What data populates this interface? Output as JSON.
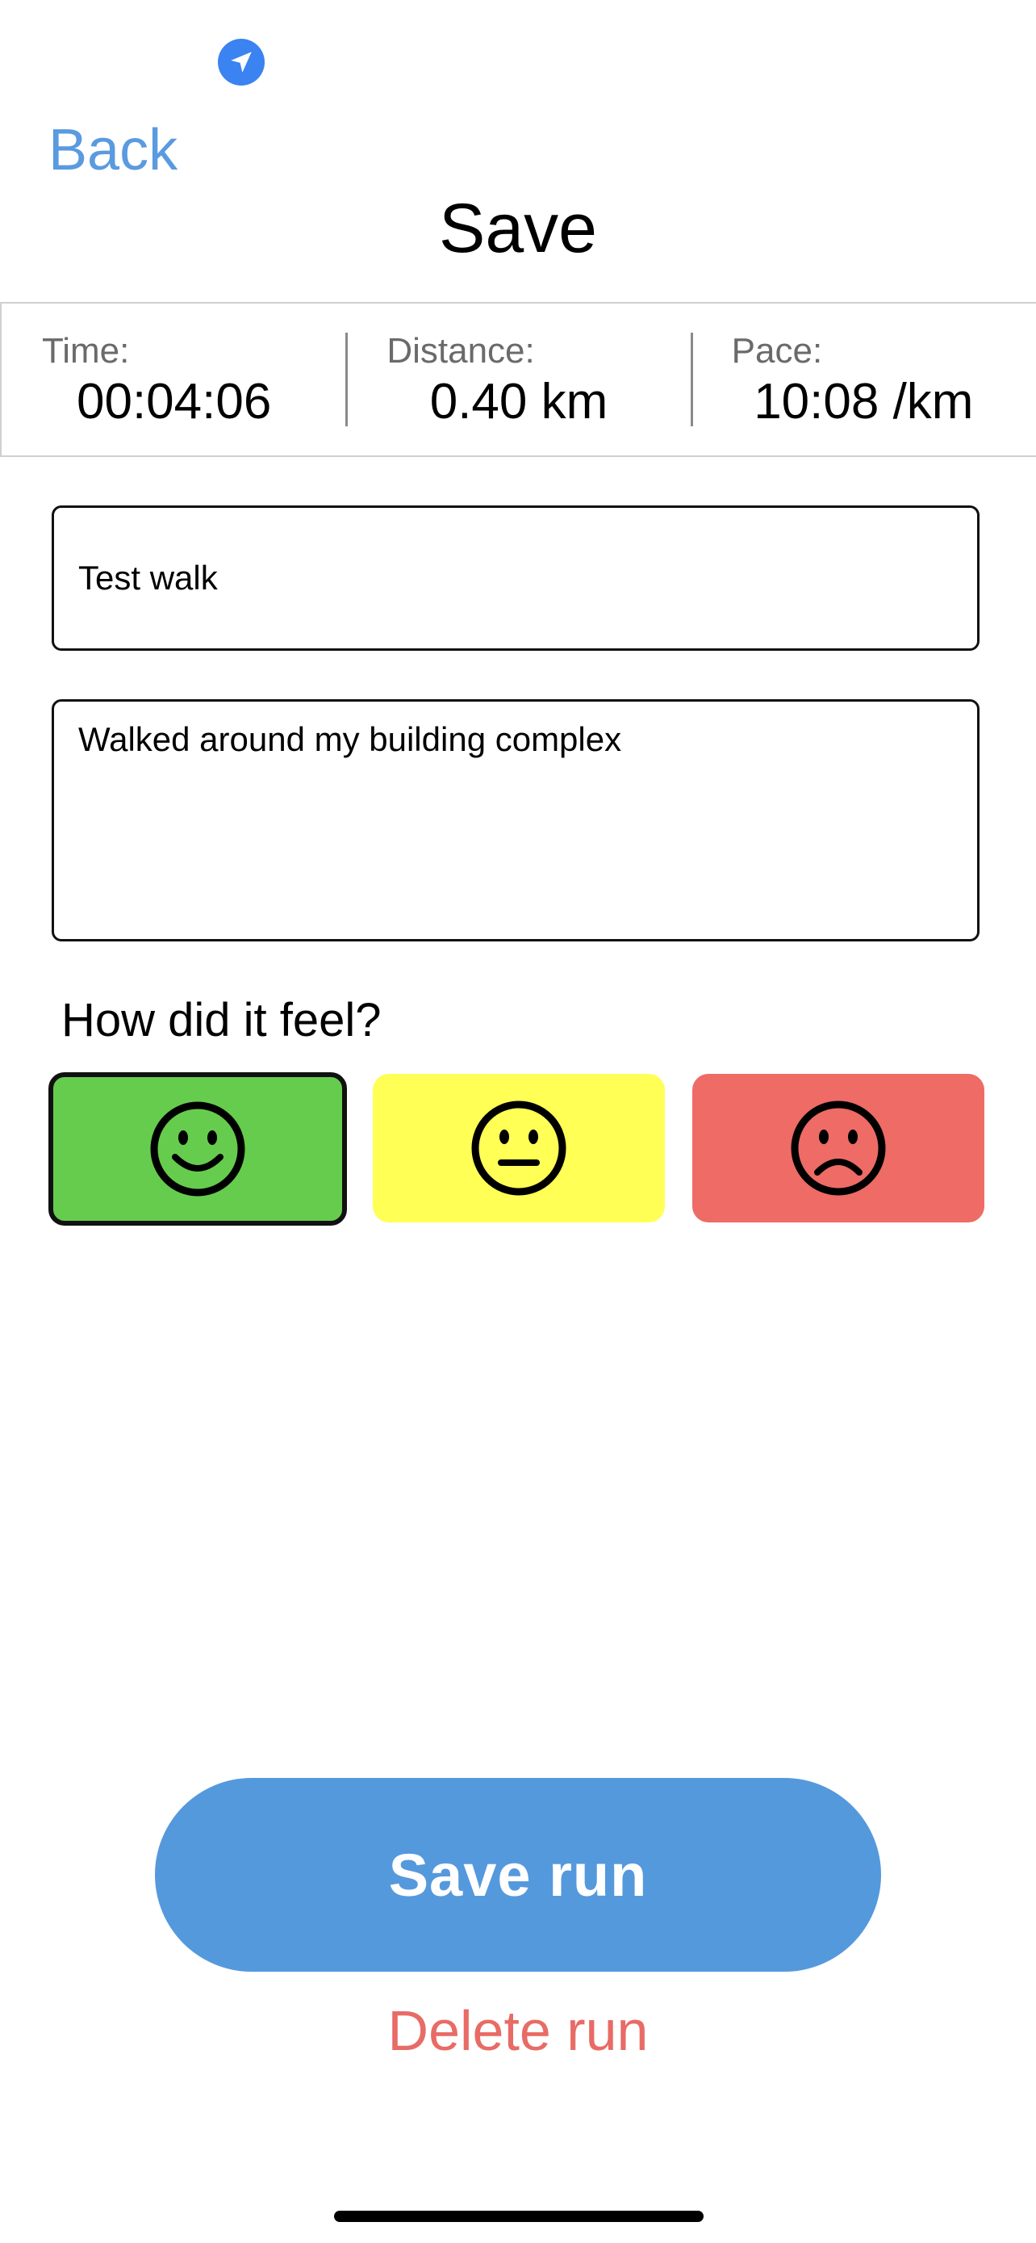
{
  "nav": {
    "back_label": "Back",
    "title": "Save"
  },
  "stats": [
    {
      "label": "Time:",
      "value": "00:04:06"
    },
    {
      "label": "Distance:",
      "value": "0.40 km"
    },
    {
      "label": "Pace:",
      "value": "10:08 /km"
    }
  ],
  "form": {
    "name_value": "Test walk",
    "notes_value": "Walked around my building complex",
    "feel_label": "How did it feel?"
  },
  "moods": [
    {
      "name": "happy",
      "icon": "smiley-face-icon",
      "color": "#66cc4d",
      "selected": true
    },
    {
      "name": "neutral",
      "icon": "neutral-face-icon",
      "color": "#ffff55",
      "selected": false
    },
    {
      "name": "sad",
      "icon": "sad-face-icon",
      "color": "#ee6b66",
      "selected": false
    }
  ],
  "actions": {
    "save_label": "Save run",
    "delete_label": "Delete run"
  },
  "colors": {
    "accent": "#5599dd",
    "link": "#5a9ae0",
    "danger": "#e86b66",
    "status_location": "#3a83f1"
  },
  "status_bar": {
    "location_icon": "location-arrow-icon"
  }
}
